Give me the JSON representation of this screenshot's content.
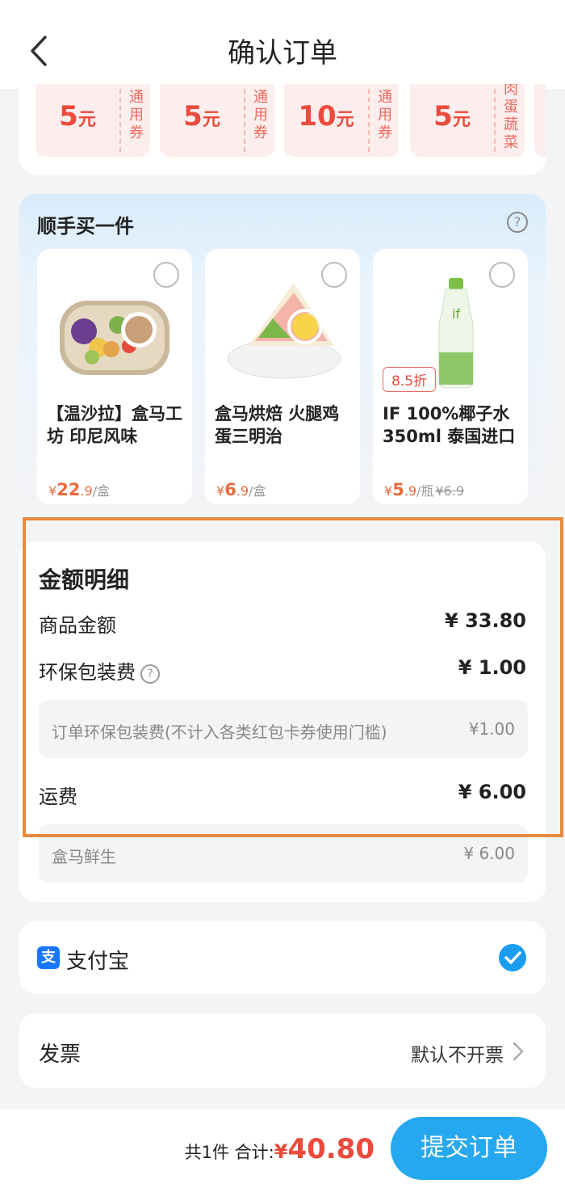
{
  "header": {
    "title": "确认订单",
    "back_icon": "chevron-left-icon"
  },
  "coupons": [
    {
      "amount": "5",
      "unit": "元",
      "tag": "通用券"
    },
    {
      "amount": "5",
      "unit": "元",
      "tag": "通用券"
    },
    {
      "amount": "10",
      "unit": "元",
      "tag": "通用券"
    },
    {
      "amount": "5",
      "unit": "元",
      "tag": "肉蛋蔬菜"
    }
  ],
  "addon": {
    "title": "顺手买一件",
    "help_icon": "question-icon",
    "products": [
      {
        "name": "【温沙拉】盒马工坊 印尼风味",
        "currency": "¥",
        "price_int": "22",
        "price_dec": ".9",
        "unit": "/盒",
        "original_price": "",
        "discount": ""
      },
      {
        "name": "盒马烘焙 火腿鸡蛋三明治",
        "currency": "¥",
        "price_int": "6",
        "price_dec": ".9",
        "unit": "/盒",
        "original_price": "",
        "discount": ""
      },
      {
        "name": "IF 100%椰子水350ml 泰国进口",
        "currency": "¥",
        "price_int": "5",
        "price_dec": ".9",
        "unit": "/瓶",
        "original_price": "¥6.9",
        "discount": "8.5折"
      }
    ]
  },
  "detail": {
    "title": "金额明细",
    "goods_label": "商品金额",
    "goods_value": "¥ 33.80",
    "packaging_label": "环保包装费",
    "packaging_value": "¥ 1.00",
    "packaging_sub_label": "订单环保包装费(不计入各类红包卡券使用门槛)",
    "packaging_sub_value": "¥1.00",
    "shipping_label": "运费",
    "shipping_value": "¥ 6.00",
    "shipping_sub_label": "盒马鲜生",
    "shipping_sub_value": "¥ 6.00"
  },
  "payment": {
    "icon_text": "支",
    "label": "支付宝",
    "selected": true
  },
  "invoice": {
    "label": "发票",
    "value": "默认不开票"
  },
  "footer": {
    "summary": "共1件 合计:",
    "currency": "¥",
    "total": "40.80",
    "submit_label": "提交订单"
  },
  "colors": {
    "accent_blue": "#26a8f0",
    "price_red": "#ea4b3c",
    "highlight_orange": "#e8893c"
  }
}
